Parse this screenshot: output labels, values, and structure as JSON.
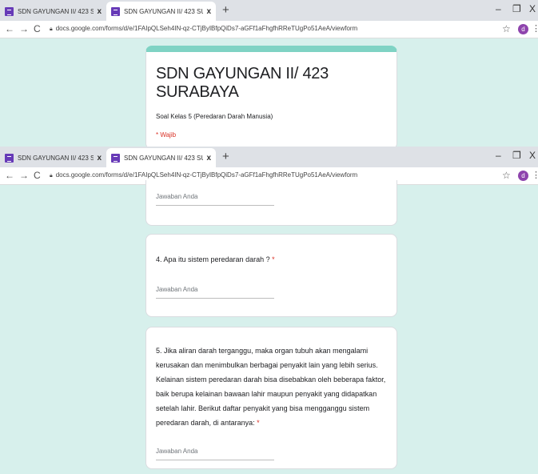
{
  "browser": {
    "tabs": [
      {
        "title": "SDN GAYUNGAN II/ 423 SURAB/",
        "close": "x"
      },
      {
        "title": "SDN GAYUNGAN II/ 423 SURAB/",
        "close": "x"
      }
    ],
    "new_tab": "+",
    "window_controls": {
      "minimize": "–",
      "restore": "❐",
      "close": "X"
    },
    "url": "docs.google.com/forms/d/e/1FAIpQLSeh4IN-qz-CTjByIBfpQiDs7-aGFf1aFhgfhRReTUgPo51AeA/viewform",
    "avatar_letter": "d"
  },
  "form": {
    "title": "SDN GAYUNGAN II/ 423 SURABAYA",
    "description": "Soal Kelas 5 (Peredaran Darah Manusia)",
    "required_note": "* Wajib"
  },
  "questions": [
    {
      "number": "",
      "text": "",
      "answer_placeholder": "Jawaban Anda"
    },
    {
      "text": "4. Apa itu sistem peredaran darah ?",
      "required": "*",
      "answer_placeholder": "Jawaban Anda"
    },
    {
      "text": "5. Jika aliran darah terganggu, maka organ tubuh akan mengalami kerusakan dan menimbulkan berbagai penyakit lain yang lebih serius. Kelainan sistem peredaran darah bisa disebabkan oleh beberapa faktor, baik berupa kelainan bawaan lahir maupun penyakit yang didapatkan setelah lahir. Berikut daftar penyakit yang bisa mengganggu sistem peredaran darah, di antaranya:",
      "required": "*",
      "answer_placeholder": "Jawaban Anda"
    }
  ]
}
